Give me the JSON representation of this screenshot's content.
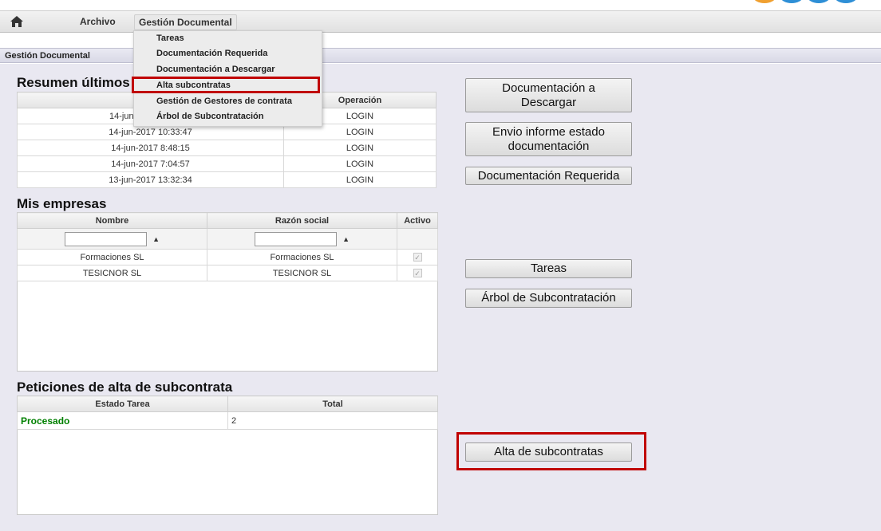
{
  "menubar": {
    "items": [
      {
        "label": "Archivo"
      },
      {
        "label": "Gestión Documental"
      }
    ]
  },
  "dropdown": {
    "items": [
      {
        "label": "Tareas"
      },
      {
        "label": "Documentación Requerida"
      },
      {
        "label": "Documentación a Descargar"
      },
      {
        "label": "Alta subcontratas"
      },
      {
        "label": "Gestión de Gestores de contrata"
      },
      {
        "label": "Árbol de Subcontratación"
      }
    ]
  },
  "page_title": "Gestión Documental",
  "resumen": {
    "title": "Resumen últimos",
    "columns": [
      "",
      "Operación"
    ],
    "rows": [
      {
        "fecha": "14-jun",
        "operacion": "LOGIN"
      },
      {
        "fecha": "14-jun-2017 10:33:47",
        "operacion": "LOGIN"
      },
      {
        "fecha": "14-jun-2017 8:48:15",
        "operacion": "LOGIN"
      },
      {
        "fecha": "14-jun-2017 7:04:57",
        "operacion": "LOGIN"
      },
      {
        "fecha": "13-jun-2017 13:32:34",
        "operacion": "LOGIN"
      }
    ]
  },
  "empresas": {
    "title": "Mis empresas",
    "columns": [
      "Nombre",
      "Razón social",
      "Activo"
    ],
    "rows": [
      {
        "nombre": "Formaciones SL",
        "razon": "Formaciones SL",
        "activo": true
      },
      {
        "nombre": "TESICNOR SL",
        "razon": "TESICNOR SL",
        "activo": true
      }
    ]
  },
  "peticiones": {
    "title": "Peticiones de alta de subcontrata",
    "columns": [
      "Estado Tarea",
      "Total"
    ],
    "rows": [
      {
        "estado": "Procesado",
        "total": "2"
      }
    ]
  },
  "buttons": {
    "doc_descargar_line1": "Documentación a",
    "doc_descargar_line2": "Descargar",
    "envio_line1": "Envio informe estado",
    "envio_line2": "documentación",
    "doc_requerida": "Documentación Requerida",
    "tareas": "Tareas",
    "arbol": "Árbol de Subcontratación",
    "alta": "Alta de subcontratas"
  },
  "colors": {
    "highlight_frame": "#c00000",
    "procesado": "#008000",
    "panel_bg": "#e9e8f1"
  },
  "icons": {
    "home": "home-icon"
  }
}
